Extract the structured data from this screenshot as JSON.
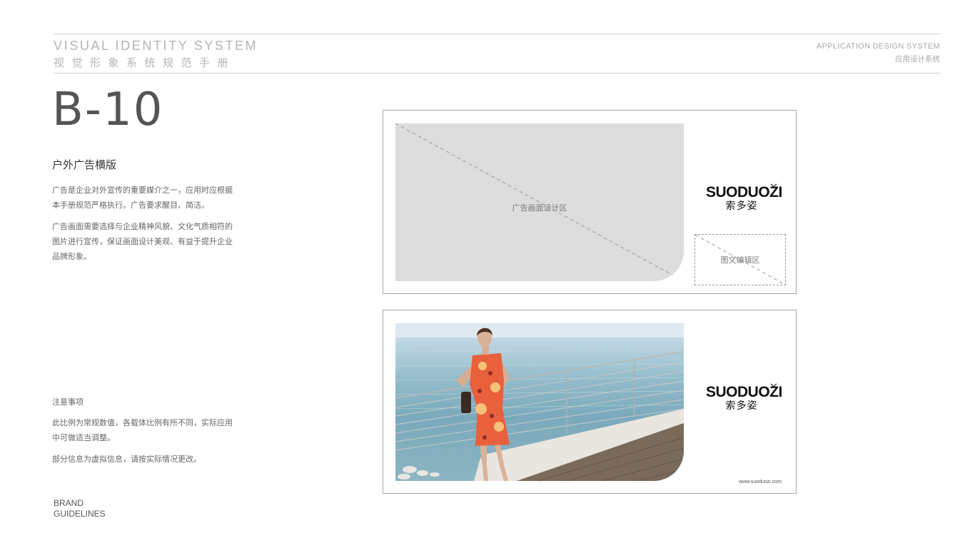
{
  "header": {
    "vis_en": "VISUAL IDENTITY SYSTEM",
    "vis_zh": "视觉形象系统规范手册",
    "app_en": "APPLICATION DESIGN SYSTEM",
    "app_zh": "应用设计系统"
  },
  "section": {
    "code": "B-10",
    "title": "户外广告横版",
    "paragraphs": [
      "广告是企业对外宣传的重要媒介之一，应用时应根据本手册规范严格执行。广告要求醒目、简洁。",
      "广告画面需要选择与企业精神风貌、文化气质相符的图片进行宣传，保证画面设计美观、有益于提升企业品牌形象。"
    ]
  },
  "notes": {
    "title": "注意事项",
    "items": [
      "此比例为常规数值，各载体比例有所不同，实际应用中可做适当调整。",
      "部分信息为虚拟信息，请按实际情况更改。"
    ]
  },
  "footer": {
    "brand_line1": "BRAND",
    "brand_line2": "GUIDELINES"
  },
  "template_board": {
    "design_area_label": "广告画面设计区",
    "edit_area_label": "图文编辑区"
  },
  "logo": {
    "en": "SUODUOZI",
    "zh": "索多姿",
    "icon": "sprout-icon"
  },
  "sample_board": {
    "url": "www.suoduozi.com"
  },
  "colors": {
    "placeholder_gray": "#dddddd",
    "rule_gray": "#cfcfcf",
    "text_dark": "#555555"
  }
}
